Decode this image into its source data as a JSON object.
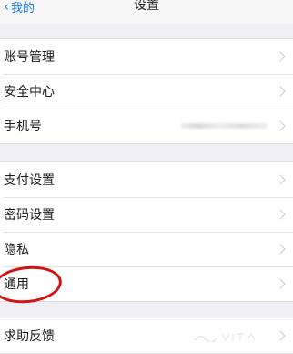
{
  "navbar": {
    "back_label": "我的",
    "title": "设置"
  },
  "groups": [
    {
      "items": [
        {
          "label": "账号管理"
        },
        {
          "label": "安全中心"
        },
        {
          "label": "手机号"
        }
      ]
    },
    {
      "items": [
        {
          "label": "支付设置"
        },
        {
          "label": "密码设置"
        },
        {
          "label": "隐私"
        },
        {
          "label": "通用"
        }
      ]
    },
    {
      "items": [
        {
          "label": "求助反馈"
        }
      ]
    }
  ],
  "colors": {
    "accent": "#1a7cf4",
    "annotation": "#d01414",
    "background": "#f0eff5"
  }
}
